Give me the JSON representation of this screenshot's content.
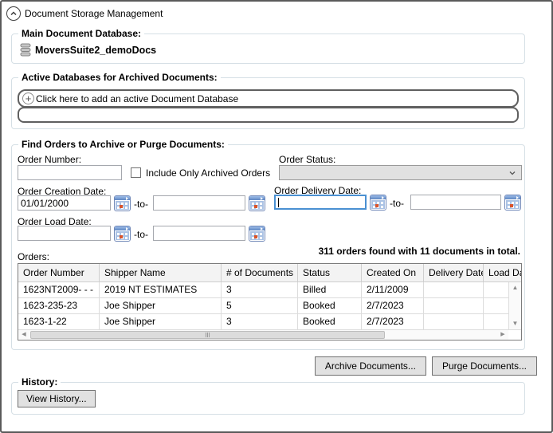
{
  "header": {
    "title": "Document Storage Management"
  },
  "main_db": {
    "label": "Main Document Database:",
    "database_name": "MoversSuite2_demoDocs"
  },
  "active_dbs": {
    "label": "Active Databases for Archived Documents:",
    "add_button_text": "Click here to add an active Document Database"
  },
  "find_orders": {
    "label": "Find Orders to Archive or Purge Documents:",
    "order_number_label": "Order Number:",
    "order_number_value": "",
    "include_archived_label": "Include Only Archived Orders",
    "order_status_label": "Order Status:",
    "order_status_value": "",
    "date_separator": "-to-",
    "creation_date": {
      "label": "Order Creation Date:",
      "from": "01/01/2000",
      "to": ""
    },
    "delivery_date": {
      "label": "Order Delivery Date:",
      "from": "",
      "to": ""
    },
    "load_date": {
      "label": "Order Load Date:",
      "from": "",
      "to": ""
    },
    "results_summary": "311 orders found with 11 documents in total.",
    "orders_label": "Orders:",
    "table": {
      "columns": [
        "Order Number",
        "Shipper Name",
        "# of Documents",
        "Status",
        "Created On",
        "Delivery Date",
        "Load Date"
      ],
      "rows": [
        [
          "1623NT2009- - -",
          "2019 NT ESTIMATES",
          "3",
          "Billed",
          "2/11/2009",
          "",
          ""
        ],
        [
          "1623-235-23",
          "Joe Shipper",
          "5",
          "Booked",
          "2/7/2023",
          "",
          ""
        ],
        [
          "1623-1-22",
          "Joe Shipper",
          "3",
          "Booked",
          "2/7/2023",
          "",
          ""
        ]
      ]
    }
  },
  "actions": {
    "archive_button": "Archive Documents...",
    "purge_button": "Purge Documents..."
  },
  "history": {
    "label": "History:",
    "view_button": "View History..."
  },
  "colors": {
    "focused_input_border": "#4a90d2",
    "calendar_accent": "#d9542b"
  }
}
